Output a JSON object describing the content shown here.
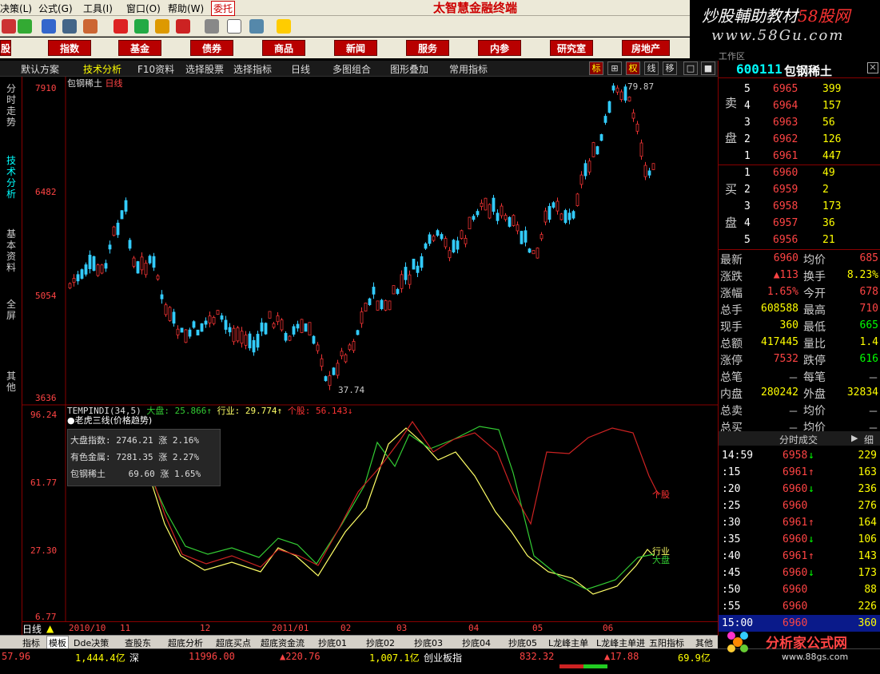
{
  "menu": [
    "决策(L)",
    "公式(G)",
    "工具(I)",
    "窗口(O)",
    "帮助(W)",
    "委托"
  ],
  "app_title": "太智慧金融终端",
  "logo": {
    "line1a": "炒股輔助教材",
    "line1b": "58股网",
    "line2": "www.58Gu.com"
  },
  "nav": [
    "股",
    "指数",
    "基金",
    "债券",
    "商品",
    "新闻",
    "服务",
    "内参",
    "研究室",
    "房地产"
  ],
  "toolbar3": [
    "默认方案",
    "技术分析",
    "F10资料",
    "选择股票",
    "选择指标",
    "日线",
    "多图组合",
    "图形叠加",
    "常用指标"
  ],
  "toolbar3_btns": [
    "标",
    "⊞",
    "权",
    "线",
    "移",
    "□",
    "■"
  ],
  "side_tabs": [
    "分时走势",
    "技术分析",
    "基本资料",
    "全屏",
    "其他"
  ],
  "main": {
    "name": "包钢稀土",
    "period": "日线",
    "ylabels": [
      "7910",
      "6482",
      "5054",
      "3636"
    ],
    "high_label": "79.87",
    "low_label": "37.74"
  },
  "indicator": {
    "name": "TEMPINDI(34,5)",
    "dapan": "大盘: 25.866↑",
    "hangye": "行业: 29.774↑",
    "gegu": "个股: 56.143↓",
    "title2": "●老虎三线(价格趋势)",
    "ylabels": [
      "96.24",
      "61.77",
      "27.30",
      "6.77"
    ],
    "tag_gegu": "个股",
    "tag_hangye": "行业",
    "tag_dapan": "大盘"
  },
  "tooltip": [
    {
      "n": "大盘指数:",
      "v": "2746.21",
      "p": "涨 2.16%"
    },
    {
      "n": "有色金属:",
      "v": "7281.35",
      "p": "涨 2.27%"
    },
    {
      "n": "包钢稀土",
      "v": "69.60",
      "p": "涨 1.65%"
    }
  ],
  "dates": [
    "2010/10",
    "11",
    "12",
    "2011/01",
    "02",
    "03",
    "04",
    "05",
    "06"
  ],
  "period_label": "日线",
  "bottom_tabs": [
    "指标",
    "模板",
    "Dde决策",
    "查股东",
    "超底分析",
    "超底买点",
    "超底资金流",
    "抄底01",
    "抄底02",
    "抄底03",
    "抄底04",
    "抄底05",
    "L龙峰主单",
    "L龙峰主单进",
    "五阳指标",
    "其他"
  ],
  "status": {
    "a": "57.96",
    "b": "1,444.4亿",
    "c": "深",
    "d": "11996.00",
    "e": "▲220.76",
    "f": "1,007.1亿",
    "g": "创业板指",
    "h": "832.32",
    "i": "▲17.88",
    "j": "69.9亿"
  },
  "quote": {
    "code": "600111",
    "name": "包钢稀土",
    "workspace": "工作区",
    "sell_label": [
      "卖",
      "盘"
    ],
    "buy_label": [
      "买",
      "盘"
    ],
    "sell": [
      {
        "n": "5",
        "p": "6965",
        "v": "399"
      },
      {
        "n": "4",
        "p": "6964",
        "v": "157"
      },
      {
        "n": "3",
        "p": "6963",
        "v": "56"
      },
      {
        "n": "2",
        "p": "6962",
        "v": "126"
      },
      {
        "n": "1",
        "p": "6961",
        "v": "447"
      }
    ],
    "buy": [
      {
        "n": "1",
        "p": "6960",
        "v": "49"
      },
      {
        "n": "2",
        "p": "6959",
        "v": "2"
      },
      {
        "n": "3",
        "p": "6958",
        "v": "173"
      },
      {
        "n": "4",
        "p": "6957",
        "v": "36"
      },
      {
        "n": "5",
        "p": "6956",
        "v": "21"
      }
    ],
    "stats": [
      {
        "l": "最新",
        "v": "6960",
        "l2": "均价",
        "v2": "685"
      },
      {
        "l": "涨跌",
        "v": "▲113",
        "l2": "换手",
        "v2": "8.23%"
      },
      {
        "l": "涨幅",
        "v": "1.65%",
        "l2": "今开",
        "v2": "678"
      },
      {
        "l": "总手",
        "v": "608588",
        "l2": "最高",
        "v2": "710"
      },
      {
        "l": "现手",
        "v": "360",
        "l2": "最低",
        "v2": "665"
      },
      {
        "l": "总额",
        "v": "417445",
        "l2": "量比",
        "v2": "1.4"
      },
      {
        "l": "涨停",
        "v": "7532",
        "l2": "跌停",
        "v2": "616"
      },
      {
        "l": "总笔",
        "v": "－",
        "l2": "每笔",
        "v2": "－"
      },
      {
        "l": "内盘",
        "v": "280242",
        "l2": "外盘",
        "v2": "32834"
      },
      {
        "l": "总卖",
        "v": "－",
        "l2": "均价",
        "v2": "－"
      },
      {
        "l": "总买",
        "v": "－",
        "l2": "均价",
        "v2": "－"
      }
    ],
    "tick_header": "分时成交",
    "tick_detail": "细",
    "ticks": [
      {
        "t": "14:59",
        "p": "6958",
        "a": "↓",
        "v": "229"
      },
      {
        "t": ":15",
        "p": "6961",
        "a": "↑",
        "v": "163"
      },
      {
        "t": ":20",
        "p": "6960",
        "a": "↓",
        "v": "236"
      },
      {
        "t": ":25",
        "p": "6960",
        "a": "",
        "v": "276"
      },
      {
        "t": ":30",
        "p": "6961",
        "a": "↑",
        "v": "164"
      },
      {
        "t": ":35",
        "p": "6960",
        "a": "↓",
        "v": "106"
      },
      {
        "t": ":40",
        "p": "6961",
        "a": "↑",
        "v": "143"
      },
      {
        "t": ":45",
        "p": "6960",
        "a": "↓",
        "v": "173"
      },
      {
        "t": ":50",
        "p": "6960",
        "a": "",
        "v": "88"
      },
      {
        "t": ":55",
        "p": "6960",
        "a": "",
        "v": "226"
      },
      {
        "t": "15:00",
        "p": "6960",
        "a": "",
        "v": "360"
      }
    ]
  },
  "bottom_logo": {
    "name": "分析家公式网",
    "url": "www.88gs.com"
  }
}
